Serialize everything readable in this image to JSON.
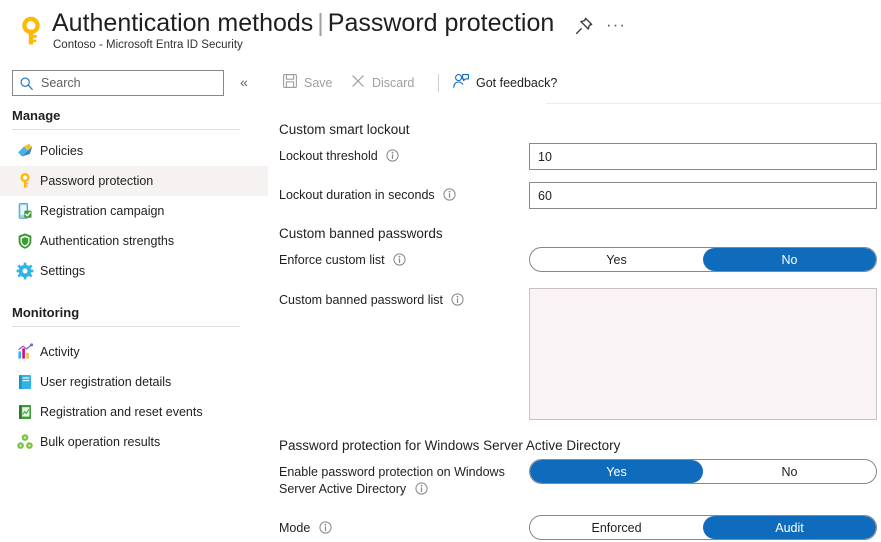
{
  "header": {
    "icon": "key-icon",
    "title_main": "Authentication methods",
    "title_sep": "|",
    "title_sub": "Password protection",
    "subtitle": "Contoso - Microsoft Entra ID Security",
    "pin_icon": "pin-icon",
    "more_icon": "ellipsis-icon",
    "more_label": "···"
  },
  "sidebar": {
    "search": {
      "placeholder": "Search",
      "value": "",
      "icon": "search-icon"
    },
    "collapse": {
      "icon": "chevron-double-left-icon",
      "label": "«"
    },
    "groups": [
      {
        "label": "Manage"
      },
      {
        "label": "Monitoring"
      }
    ],
    "manage_items": [
      {
        "label": "Policies",
        "icon": "policies-icon",
        "active": false
      },
      {
        "label": "Password protection",
        "icon": "key-icon",
        "active": true
      },
      {
        "label": "Registration campaign",
        "icon": "registration-campaign-icon",
        "active": false
      },
      {
        "label": "Authentication strengths",
        "icon": "shield-icon",
        "active": false
      },
      {
        "label": "Settings",
        "icon": "gear-icon",
        "active": false
      }
    ],
    "monitoring_items": [
      {
        "label": "Activity",
        "icon": "activity-chart-icon",
        "active": false
      },
      {
        "label": "User registration details",
        "icon": "book-icon",
        "active": false
      },
      {
        "label": "Registration and reset events",
        "icon": "report-icon",
        "active": false
      },
      {
        "label": "Bulk operation results",
        "icon": "bulk-operations-icon",
        "active": false
      }
    ]
  },
  "toolbar": {
    "save_label": "Save",
    "save_icon": "save-disk-icon",
    "save_disabled": true,
    "discard_label": "Discard",
    "discard_icon": "close-x-icon",
    "discard_disabled": true,
    "feedback_label": "Got feedback?",
    "feedback_icon": "person-feedback-icon"
  },
  "form": {
    "section_lockout": "Custom smart lockout",
    "lockout_threshold": {
      "label": "Lockout threshold",
      "info_icon": "info-icon",
      "value": "10"
    },
    "lockout_duration": {
      "label": "Lockout duration in seconds",
      "info_icon": "info-icon",
      "value": "60"
    },
    "section_banned": "Custom banned passwords",
    "enforce_custom_list": {
      "label": "Enforce custom list",
      "info_icon": "info-icon",
      "options": [
        "Yes",
        "No"
      ],
      "selected": "No"
    },
    "banned_password_list": {
      "label": "Custom banned password list",
      "info_icon": "info-icon",
      "value": "",
      "disabled": true
    },
    "section_windows": "Password protection for Windows Server Active Directory",
    "enable_on_windows": {
      "label_line1": "Enable password protection on Windows",
      "label_line2": "Server Active Directory",
      "info_icon": "info-icon",
      "options": [
        "Yes",
        "No"
      ],
      "selected": "Yes"
    },
    "mode": {
      "label": "Mode",
      "info_icon": "info-icon",
      "options": [
        "Enforced",
        "Audit"
      ],
      "selected": "Audit"
    }
  },
  "colors": {
    "accent": "#0f6cbd",
    "key_gold": "#ffb900",
    "text": "#201f1e",
    "muted": "#605e5c",
    "disabled": "#a19f9d",
    "rule": "#e1dfdd",
    "active_row": "#f5f2f1",
    "disabled_field_bg": "#f9f3f6"
  }
}
